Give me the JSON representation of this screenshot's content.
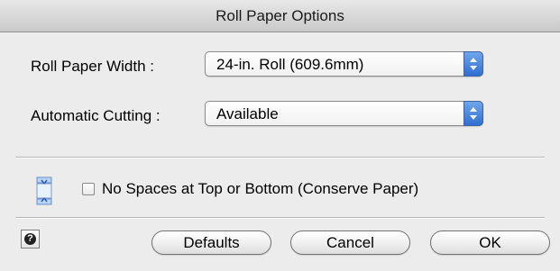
{
  "dialog": {
    "title": "Roll Paper Options"
  },
  "roll_paper_width": {
    "label": "Roll Paper Width :",
    "value": "24-in. Roll (609.6mm)"
  },
  "automatic_cutting": {
    "label": "Automatic Cutting :",
    "value": "Available"
  },
  "conserve": {
    "label": "No Spaces at Top or Bottom (Conserve Paper)",
    "checked": false,
    "icon": "conserve-paper-icon"
  },
  "buttons": {
    "help": "?",
    "defaults": "Defaults",
    "cancel": "Cancel",
    "ok": "OK"
  },
  "colors": {
    "popup_arrow": "#2f6fd2",
    "background": "#ececec"
  }
}
